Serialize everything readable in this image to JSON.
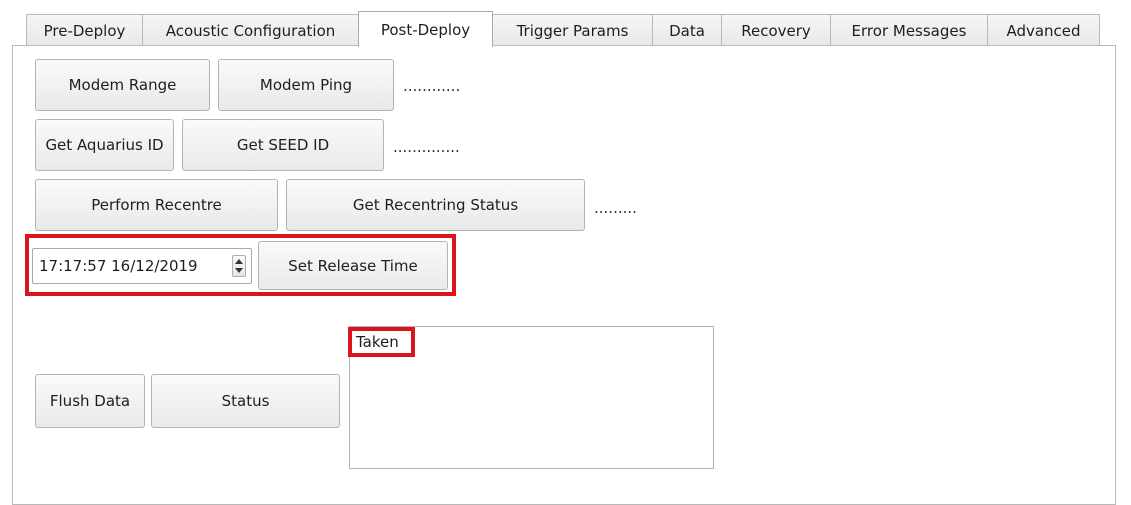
{
  "tabs": [
    {
      "label": "Pre-Deploy",
      "active": false
    },
    {
      "label": "Acoustic Configuration",
      "active": false
    },
    {
      "label": "Post-Deploy",
      "active": true
    },
    {
      "label": "Trigger Params",
      "active": false
    },
    {
      "label": "Data",
      "active": false
    },
    {
      "label": "Recovery",
      "active": false
    },
    {
      "label": "Error Messages",
      "active": false
    },
    {
      "label": "Advanced",
      "active": false
    }
  ],
  "post_deploy": {
    "modem_range_label": "Modem Range",
    "modem_ping_label": "Modem Ping",
    "modem_result": "............",
    "get_aquarius_id_label": "Get Aquarius ID",
    "get_seed_id_label": "Get SEED ID",
    "id_result": "..............",
    "perform_recentre_label": "Perform Recentre",
    "get_recentring_status_label": "Get Recentring Status",
    "recentre_result": ".........",
    "release_datetime": "17:17:57 16/12/2019",
    "set_release_time_label": "Set Release Time",
    "flush_data_label": "Flush Data",
    "status_label": "Status",
    "status_output": "Taken"
  },
  "colors": {
    "highlight": "#d9141b"
  }
}
